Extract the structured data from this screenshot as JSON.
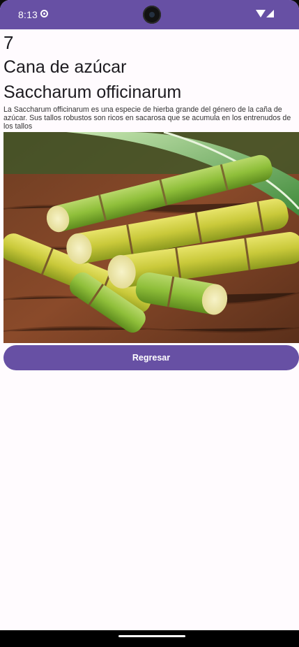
{
  "status_bar": {
    "time": "8:13",
    "settings_icon": "gear-icon",
    "wifi_icon": "wifi-icon",
    "signal_icon": "cell-signal-icon",
    "background_color": "#6750a4"
  },
  "plant": {
    "number": "7",
    "common_name": "Cana de azúcar",
    "scientific_name": "Saccharum officinarum",
    "description": "La Saccharum officinarum es una especie de hierba grande del género de la caña de azúcar. Sus tallos robustos son ricos en sacarosa que se acumula en los entrenudos de los tallos"
  },
  "actions": {
    "back_label": "Regresar",
    "button_color": "#6750a4"
  }
}
